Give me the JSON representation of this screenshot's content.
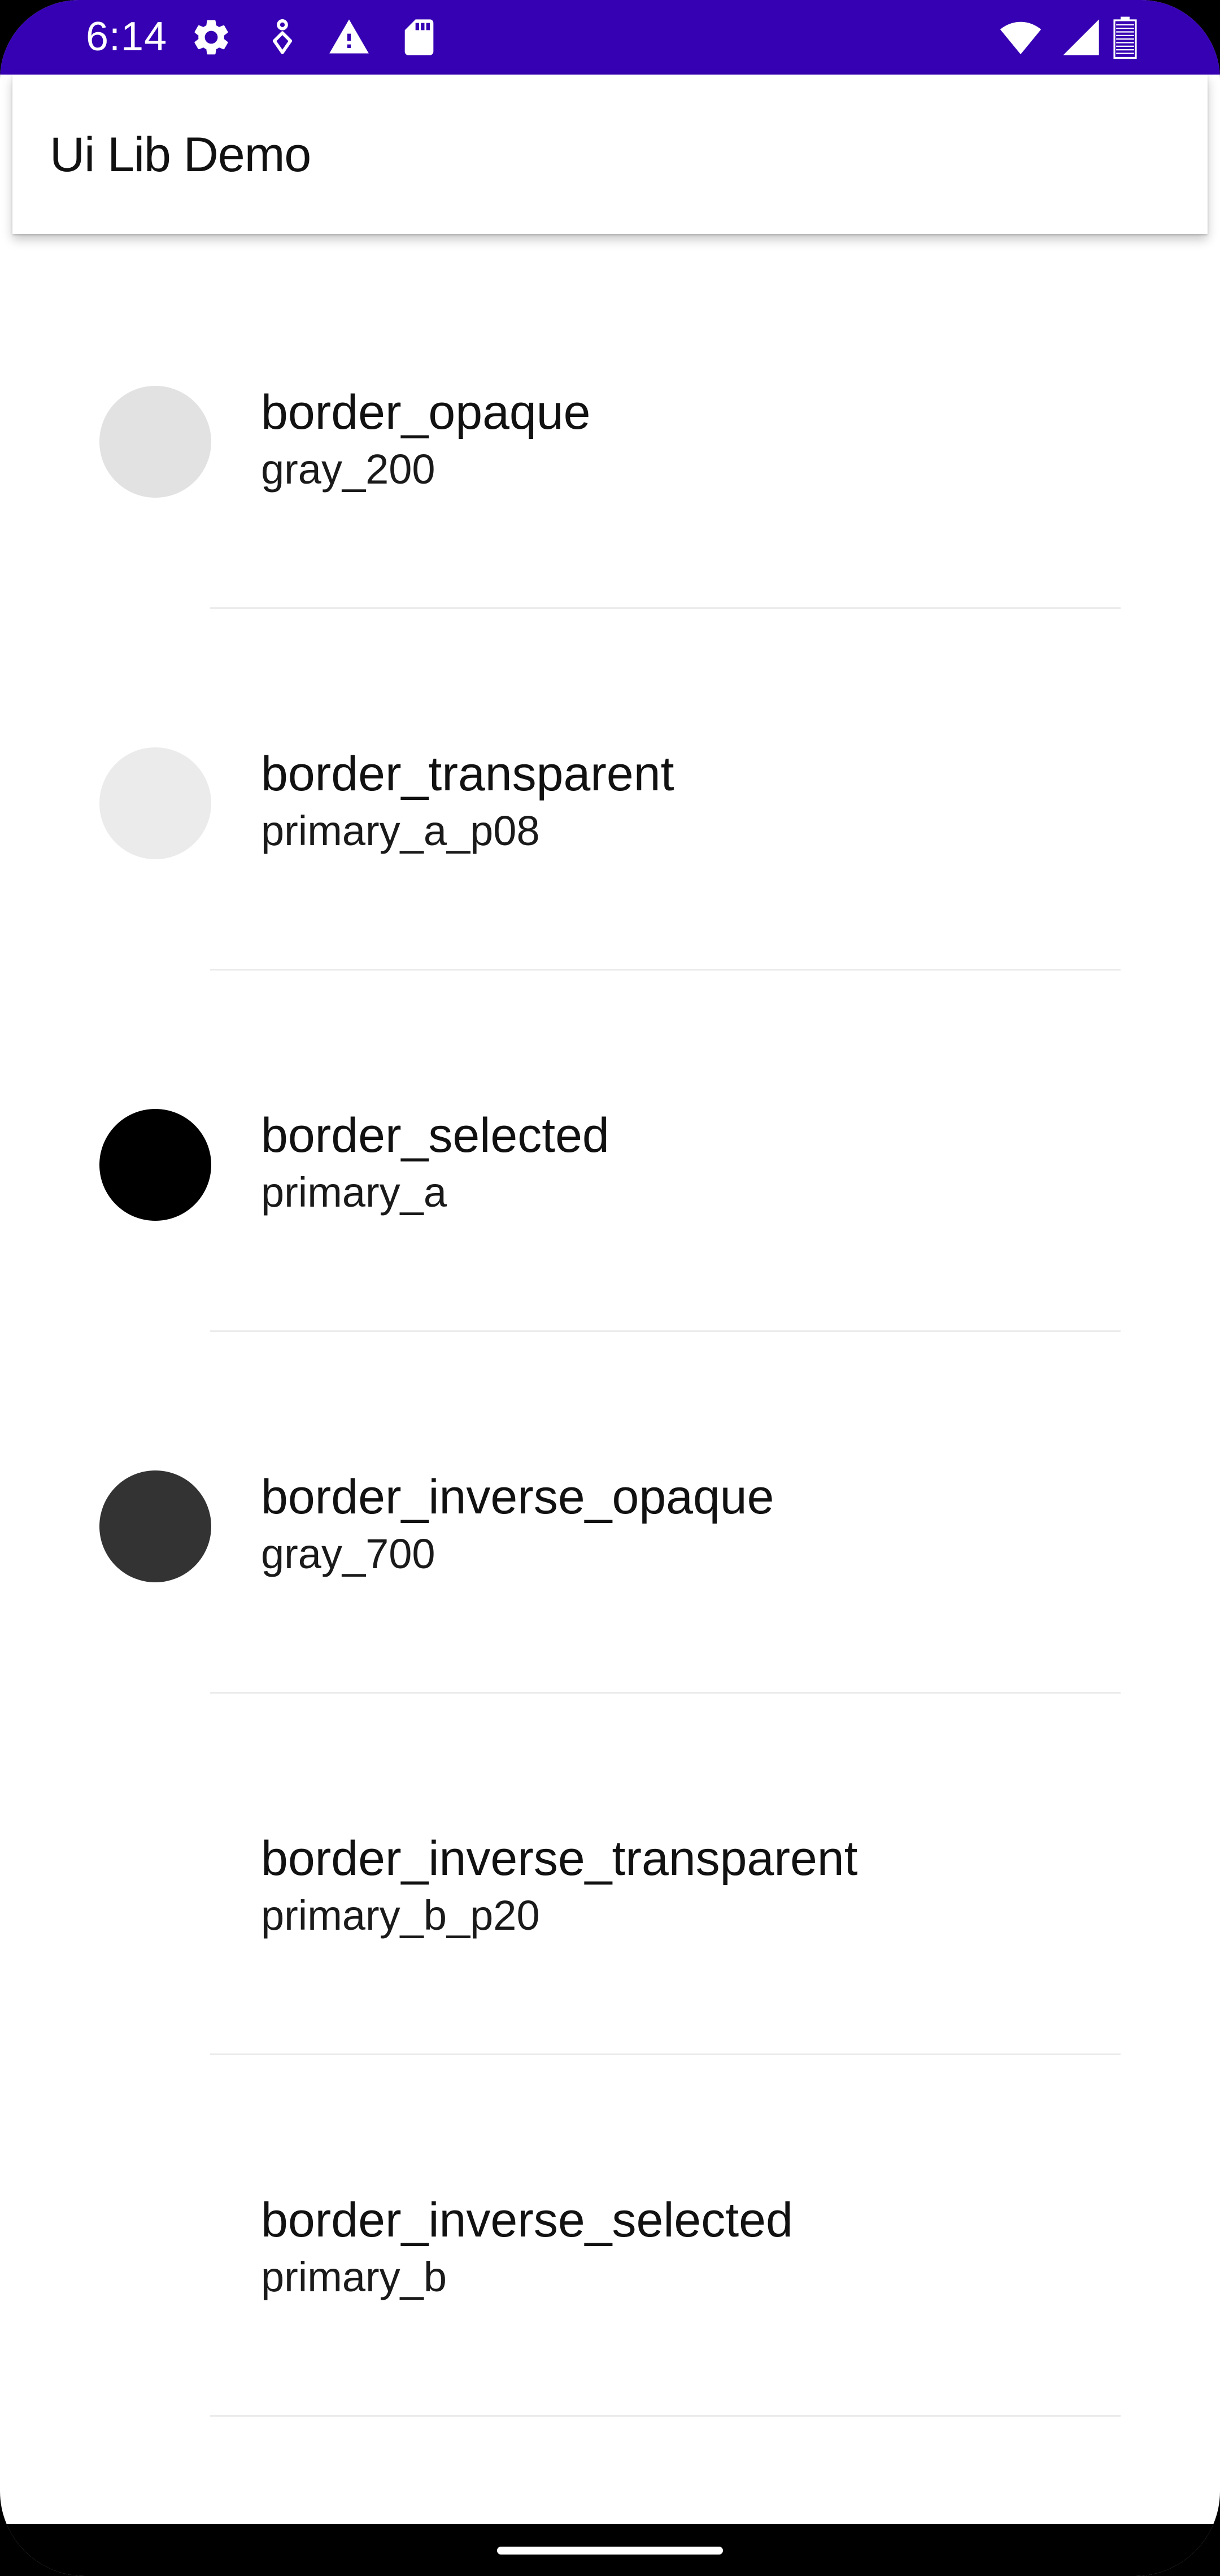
{
  "status_bar": {
    "time": "6:14",
    "background": "#3600b3",
    "left_icons": [
      "settings-icon",
      "accessibility-icon",
      "warning-icon",
      "sd-card-icon"
    ],
    "right_icons": [
      "wifi-icon",
      "cellular-signal-icon",
      "battery-icon"
    ]
  },
  "app_bar": {
    "title": "Ui Lib Demo"
  },
  "items": [
    {
      "title": "border_opaque",
      "subtitle": "gray_200",
      "color": "#e2e2e2"
    },
    {
      "title": "border_transparent",
      "subtitle": "primary_a_p08",
      "color": "#ebebeb"
    },
    {
      "title": "border_selected",
      "subtitle": "primary_a",
      "color": "#000000"
    },
    {
      "title": "border_inverse_opaque",
      "subtitle": "gray_700",
      "color": "#333333"
    },
    {
      "title": "border_inverse_transparent",
      "subtitle": "primary_b_p20",
      "color": "#ffffff"
    },
    {
      "title": "border_inverse_selected",
      "subtitle": "primary_b",
      "color": "#ffffff"
    }
  ]
}
